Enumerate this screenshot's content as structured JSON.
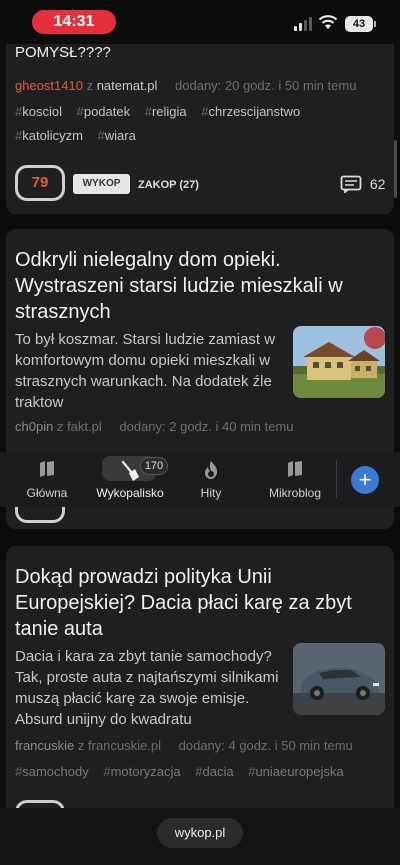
{
  "status_bar": {
    "time": "14:31",
    "battery": "43"
  },
  "posts": [
    {
      "title_fragment": "POMYSŁ????",
      "author": "gheost1410",
      "source_prefix": "z",
      "source": "natemat.pl",
      "added": "dodany: 20 godz. i 50 min temu",
      "tags": [
        "kosciol",
        "podatek",
        "religia",
        "chrzescijanstwo",
        "katolicyzm",
        "wiara"
      ],
      "votes": "79",
      "wykop_label": "WYKOP",
      "zakop_label": "ZAKOP (27)",
      "comments": "62"
    },
    {
      "title": "Odkryli nielegalny dom opieki. Wystraszeni starsi ludzie mieszkali w strasznych",
      "excerpt": "To był koszmar. Starsi ludzie zamiast w komfortowym domu opieki mieszkali w strasznych warunkach. Na dodatek źle traktow",
      "author": "ch0pin",
      "source_prefix": "z",
      "source": "fakt.pl",
      "added": "dodany: 2 godz. i 40 min temu"
    },
    {
      "title": "Dokąd prowadzi polityka Unii Europejskiej? Dacia płaci karę za zbyt tanie auta",
      "excerpt": "Dacia i kara za zbyt tanie samochody? Tak, proste auta z najtańszymi silnikami muszą płacić karę za swoje emisje. Absurd unijny do kwadratu",
      "author": "francuskie",
      "source_prefix": "z",
      "source": "francuskie.pl",
      "added": "dodany: 4 godz. i 50 min temu",
      "tags": [
        "samochody",
        "motoryzacja",
        "dacia",
        "uniaeuropejska"
      ]
    }
  ],
  "tabbar": {
    "items": [
      {
        "label": "Główna",
        "icon": "home-icon"
      },
      {
        "label": "Wykopalisko",
        "icon": "shovel-icon",
        "badge": "170"
      },
      {
        "label": "Hity",
        "icon": "flame-icon"
      },
      {
        "label": "Mikroblog",
        "icon": "mikroblog-icon"
      }
    ],
    "add_icon": "plus-icon"
  },
  "urlbar": {
    "url": "wykop.pl"
  },
  "colors": {
    "accent": "#e25b3b",
    "background": "#0c0c0d",
    "card": "#1f1f21",
    "plus": "#3a7bd5",
    "time_pill": "#e5303b"
  }
}
